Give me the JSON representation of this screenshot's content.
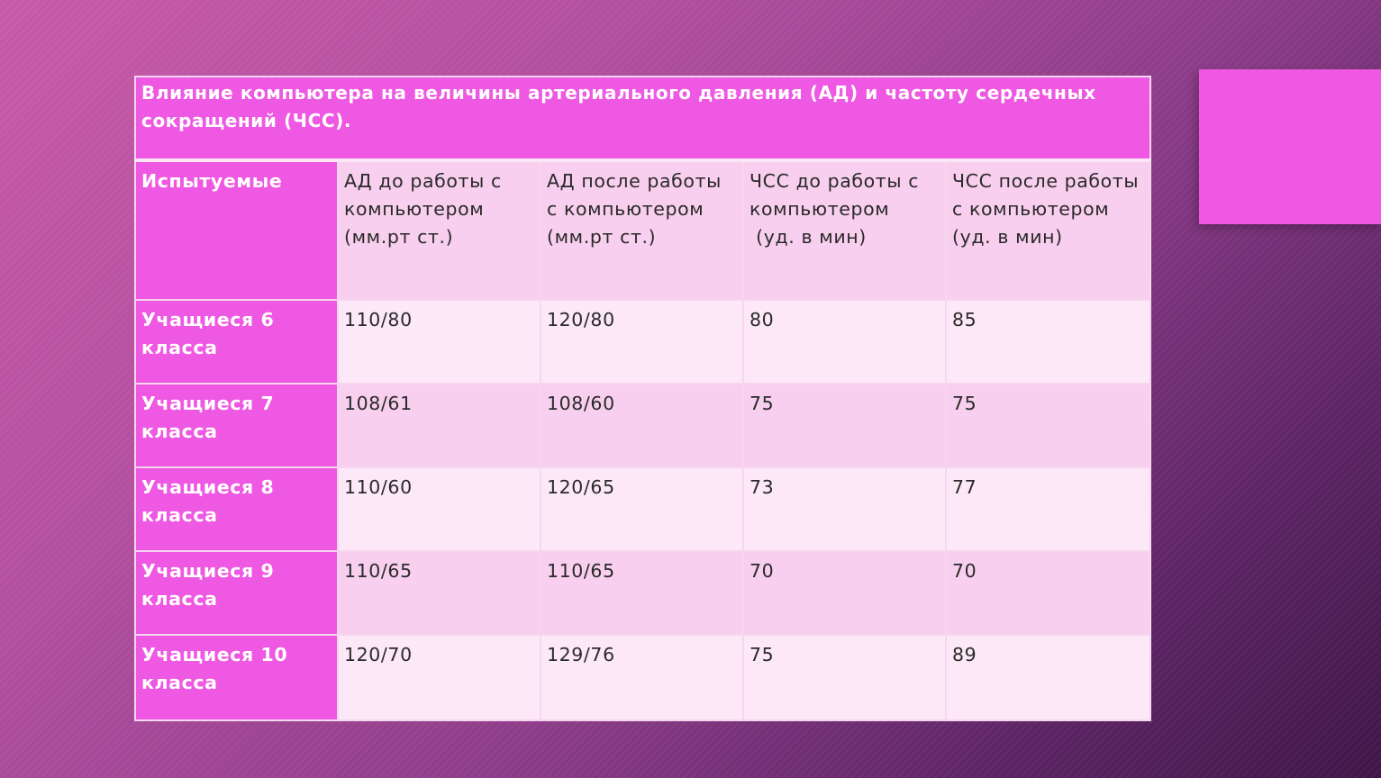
{
  "table": {
    "caption": "Влияние компьютера на величины артериального давления (АД) и частоту сердечных сокращений (ЧСС).",
    "headers": [
      "Испытуемые",
      "АД до работы с компьютером\n(мм.рт ст.)",
      "АД после работы с компьютером\n(мм.рт ст.)",
      "ЧСС до работы с компьютером\n (уд. в мин)",
      "ЧСС после работы с компьютером\n(уд. в мин)"
    ],
    "rows": [
      [
        "Учащиеся 6 класса",
        "110/80",
        "120/80",
        "80",
        "85"
      ],
      [
        "Учащиеся 7 класса",
        "108/61",
        "108/60",
        "75",
        "75"
      ],
      [
        "Учащиеся 8 класса",
        "110/60",
        "120/65",
        "73",
        "77"
      ],
      [
        "Учащиеся 9 класса",
        "110/65",
        "110/65",
        "70",
        "70"
      ],
      [
        "Учащиеся 10 класса",
        "120/70",
        "129/76",
        "75",
        "89"
      ]
    ]
  },
  "colors": {
    "accent_pink": "#ef58e2",
    "cell_dark": "#f8cfee",
    "cell_light": "#fde8f8"
  }
}
